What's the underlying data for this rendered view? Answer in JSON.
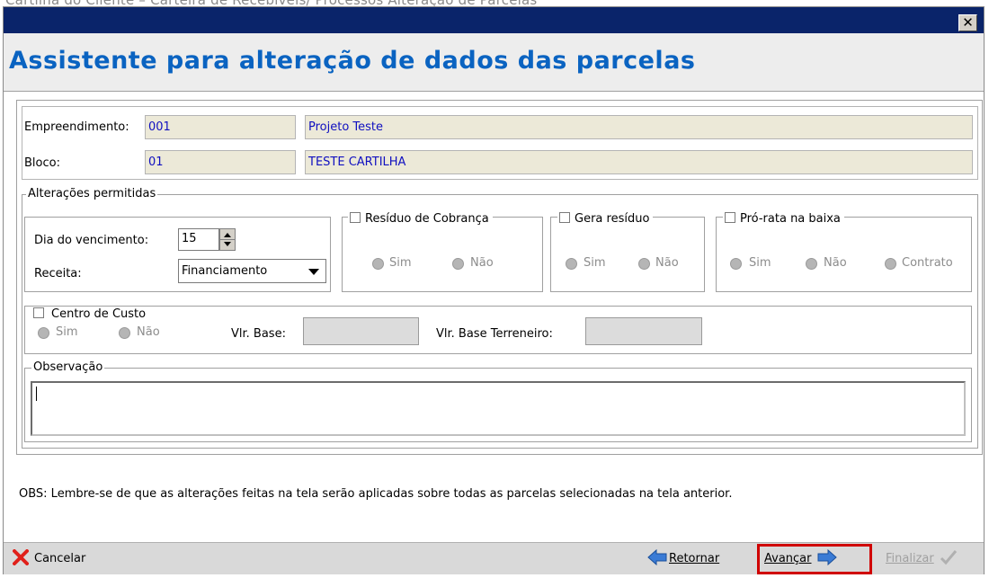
{
  "caption": "Cartilha do Cliente – Carteira de Recebíveis/ Processos Alteração de Parcelas",
  "window": {
    "close_glyph": "✕"
  },
  "header": {
    "title": "Assistente para alteração de dados das parcelas"
  },
  "fields": {
    "empreendimento_label": "Empreendimento:",
    "empreendimento_code": "001",
    "empreendimento_name": "Projeto Teste",
    "bloco_label": "Bloco:",
    "bloco_code": "01",
    "bloco_name": "TESTE CARTILHA"
  },
  "alteracoes": {
    "title": "Alterações permitidas",
    "dia_label": "Dia do vencimento:",
    "dia_value": "15",
    "receita_label": "Receita:",
    "receita_value": "Financiamento",
    "residuo_cobranca": {
      "label": "Resíduo de Cobrança",
      "options": [
        "Sim",
        "Não"
      ]
    },
    "gera_residuo": {
      "label": "Gera resíduo",
      "options": [
        "Sim",
        "Não"
      ]
    },
    "pro_rata": {
      "label": "Pró-rata na baixa",
      "options": [
        "Sim",
        "Não",
        "Contrato"
      ]
    },
    "centro_custo": {
      "label": "Centro de Custo",
      "options": [
        "Sim",
        "Não"
      ],
      "vlr_base_label": "Vlr. Base:",
      "vlr_base_terreneiro_label": "Vlr. Base Terreneiro:"
    },
    "observacao_label": "Observação"
  },
  "note": "OBS: Lembre-se de que as alterações feitas na tela serão aplicadas sobre todas as parcelas selecionadas na tela anterior.",
  "footer": {
    "cancelar": "Cancelar",
    "retornar": "Retornar",
    "avancar": "Avançar",
    "finalizar": "Finalizar"
  },
  "colors": {
    "title": "#0a63c1",
    "titlebar": "#0a246a",
    "highlight": "#d00000",
    "field_text": "#1010c0"
  },
  "icons": [
    "close-icon",
    "cancel-x-icon",
    "arrow-left-icon",
    "arrow-right-icon",
    "checkmark-icon",
    "spinner-up-icon",
    "spinner-down-icon",
    "dropdown-arrow-icon"
  ]
}
